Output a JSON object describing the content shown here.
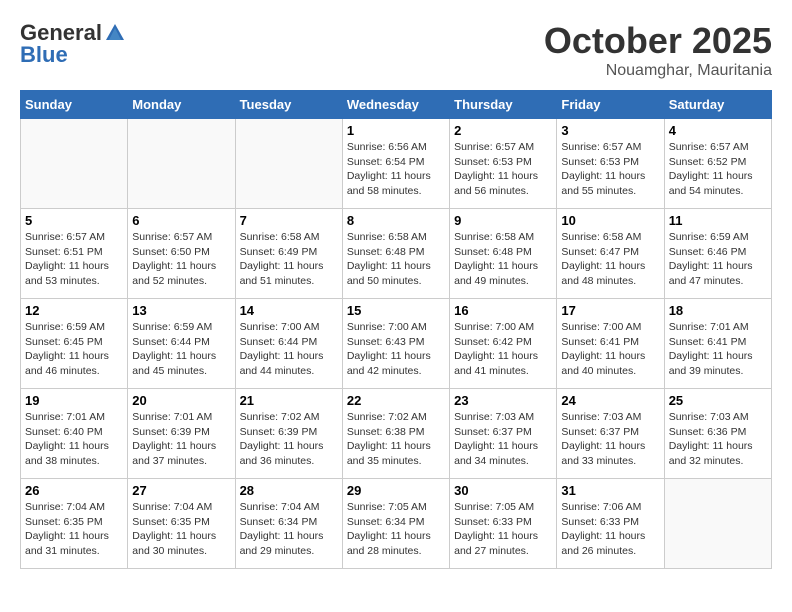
{
  "header": {
    "logo_general": "General",
    "logo_blue": "Blue",
    "month_title": "October 2025",
    "location": "Nouamghar, Mauritania"
  },
  "weekdays": [
    "Sunday",
    "Monday",
    "Tuesday",
    "Wednesday",
    "Thursday",
    "Friday",
    "Saturday"
  ],
  "weeks": [
    [
      {
        "day": "",
        "info": ""
      },
      {
        "day": "",
        "info": ""
      },
      {
        "day": "",
        "info": ""
      },
      {
        "day": "1",
        "info": "Sunrise: 6:56 AM\nSunset: 6:54 PM\nDaylight: 11 hours\nand 58 minutes."
      },
      {
        "day": "2",
        "info": "Sunrise: 6:57 AM\nSunset: 6:53 PM\nDaylight: 11 hours\nand 56 minutes."
      },
      {
        "day": "3",
        "info": "Sunrise: 6:57 AM\nSunset: 6:53 PM\nDaylight: 11 hours\nand 55 minutes."
      },
      {
        "day": "4",
        "info": "Sunrise: 6:57 AM\nSunset: 6:52 PM\nDaylight: 11 hours\nand 54 minutes."
      }
    ],
    [
      {
        "day": "5",
        "info": "Sunrise: 6:57 AM\nSunset: 6:51 PM\nDaylight: 11 hours\nand 53 minutes."
      },
      {
        "day": "6",
        "info": "Sunrise: 6:57 AM\nSunset: 6:50 PM\nDaylight: 11 hours\nand 52 minutes."
      },
      {
        "day": "7",
        "info": "Sunrise: 6:58 AM\nSunset: 6:49 PM\nDaylight: 11 hours\nand 51 minutes."
      },
      {
        "day": "8",
        "info": "Sunrise: 6:58 AM\nSunset: 6:48 PM\nDaylight: 11 hours\nand 50 minutes."
      },
      {
        "day": "9",
        "info": "Sunrise: 6:58 AM\nSunset: 6:48 PM\nDaylight: 11 hours\nand 49 minutes."
      },
      {
        "day": "10",
        "info": "Sunrise: 6:58 AM\nSunset: 6:47 PM\nDaylight: 11 hours\nand 48 minutes."
      },
      {
        "day": "11",
        "info": "Sunrise: 6:59 AM\nSunset: 6:46 PM\nDaylight: 11 hours\nand 47 minutes."
      }
    ],
    [
      {
        "day": "12",
        "info": "Sunrise: 6:59 AM\nSunset: 6:45 PM\nDaylight: 11 hours\nand 46 minutes."
      },
      {
        "day": "13",
        "info": "Sunrise: 6:59 AM\nSunset: 6:44 PM\nDaylight: 11 hours\nand 45 minutes."
      },
      {
        "day": "14",
        "info": "Sunrise: 7:00 AM\nSunset: 6:44 PM\nDaylight: 11 hours\nand 44 minutes."
      },
      {
        "day": "15",
        "info": "Sunrise: 7:00 AM\nSunset: 6:43 PM\nDaylight: 11 hours\nand 42 minutes."
      },
      {
        "day": "16",
        "info": "Sunrise: 7:00 AM\nSunset: 6:42 PM\nDaylight: 11 hours\nand 41 minutes."
      },
      {
        "day": "17",
        "info": "Sunrise: 7:00 AM\nSunset: 6:41 PM\nDaylight: 11 hours\nand 40 minutes."
      },
      {
        "day": "18",
        "info": "Sunrise: 7:01 AM\nSunset: 6:41 PM\nDaylight: 11 hours\nand 39 minutes."
      }
    ],
    [
      {
        "day": "19",
        "info": "Sunrise: 7:01 AM\nSunset: 6:40 PM\nDaylight: 11 hours\nand 38 minutes."
      },
      {
        "day": "20",
        "info": "Sunrise: 7:01 AM\nSunset: 6:39 PM\nDaylight: 11 hours\nand 37 minutes."
      },
      {
        "day": "21",
        "info": "Sunrise: 7:02 AM\nSunset: 6:39 PM\nDaylight: 11 hours\nand 36 minutes."
      },
      {
        "day": "22",
        "info": "Sunrise: 7:02 AM\nSunset: 6:38 PM\nDaylight: 11 hours\nand 35 minutes."
      },
      {
        "day": "23",
        "info": "Sunrise: 7:03 AM\nSunset: 6:37 PM\nDaylight: 11 hours\nand 34 minutes."
      },
      {
        "day": "24",
        "info": "Sunrise: 7:03 AM\nSunset: 6:37 PM\nDaylight: 11 hours\nand 33 minutes."
      },
      {
        "day": "25",
        "info": "Sunrise: 7:03 AM\nSunset: 6:36 PM\nDaylight: 11 hours\nand 32 minutes."
      }
    ],
    [
      {
        "day": "26",
        "info": "Sunrise: 7:04 AM\nSunset: 6:35 PM\nDaylight: 11 hours\nand 31 minutes."
      },
      {
        "day": "27",
        "info": "Sunrise: 7:04 AM\nSunset: 6:35 PM\nDaylight: 11 hours\nand 30 minutes."
      },
      {
        "day": "28",
        "info": "Sunrise: 7:04 AM\nSunset: 6:34 PM\nDaylight: 11 hours\nand 29 minutes."
      },
      {
        "day": "29",
        "info": "Sunrise: 7:05 AM\nSunset: 6:34 PM\nDaylight: 11 hours\nand 28 minutes."
      },
      {
        "day": "30",
        "info": "Sunrise: 7:05 AM\nSunset: 6:33 PM\nDaylight: 11 hours\nand 27 minutes."
      },
      {
        "day": "31",
        "info": "Sunrise: 7:06 AM\nSunset: 6:33 PM\nDaylight: 11 hours\nand 26 minutes."
      },
      {
        "day": "",
        "info": ""
      }
    ]
  ]
}
